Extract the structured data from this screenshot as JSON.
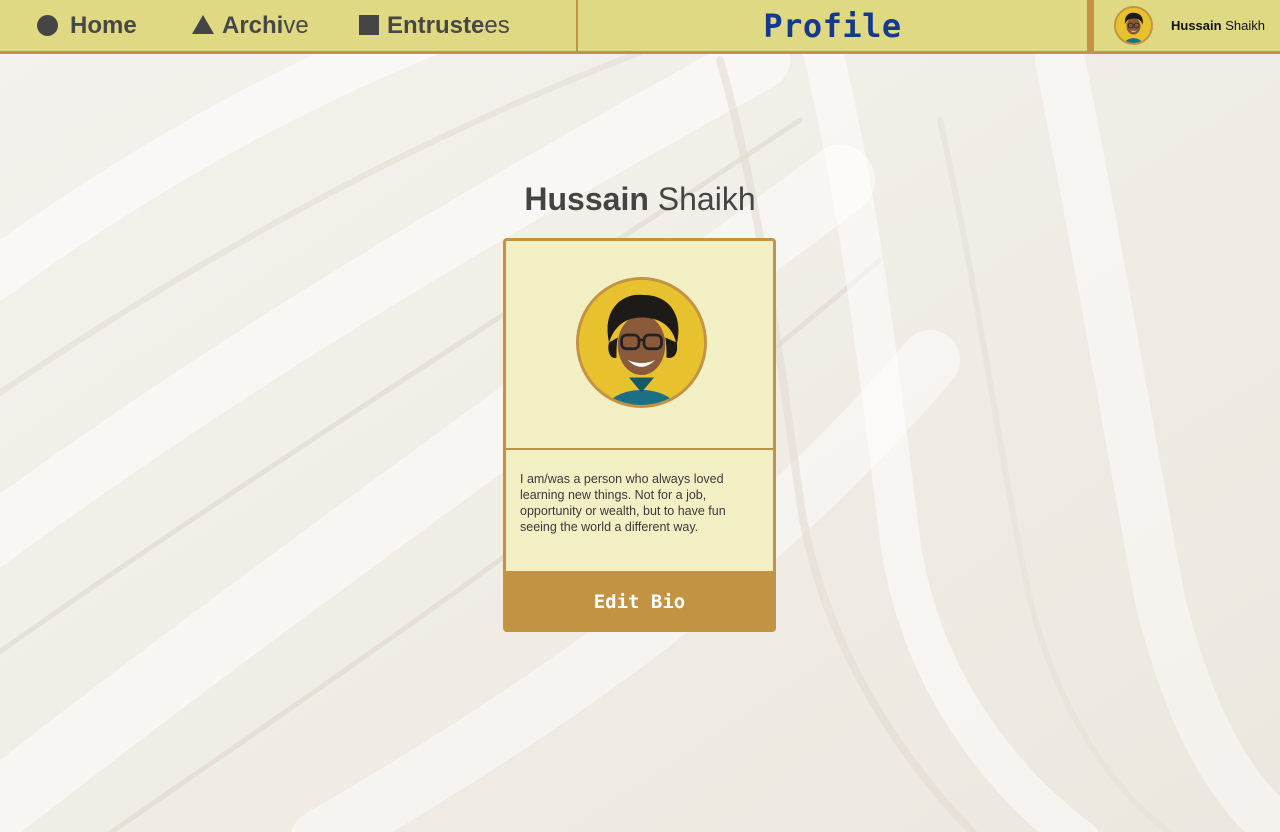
{
  "nav": {
    "home": {
      "strong": "Home",
      "light": ""
    },
    "archive": {
      "strong": "Archi",
      "light": "ve"
    },
    "entrustees": {
      "strong": "Entruste",
      "light": "es"
    }
  },
  "header": {
    "title": "Profile"
  },
  "user": {
    "first_name": "Hussain",
    "last_name": "Shaikh"
  },
  "profile": {
    "first_name": "Hussain",
    "last_name": "Shaikh",
    "bio": "I am/was a person who always loved learning new things. Not for a job, opportunity or wealth, but to have fun seeing the world a different way.",
    "edit_bio_label": "Edit Bio"
  },
  "colors": {
    "topbar": "#e0d984",
    "accent": "#c29342",
    "title": "#15398c",
    "card": "#f3efc4"
  }
}
